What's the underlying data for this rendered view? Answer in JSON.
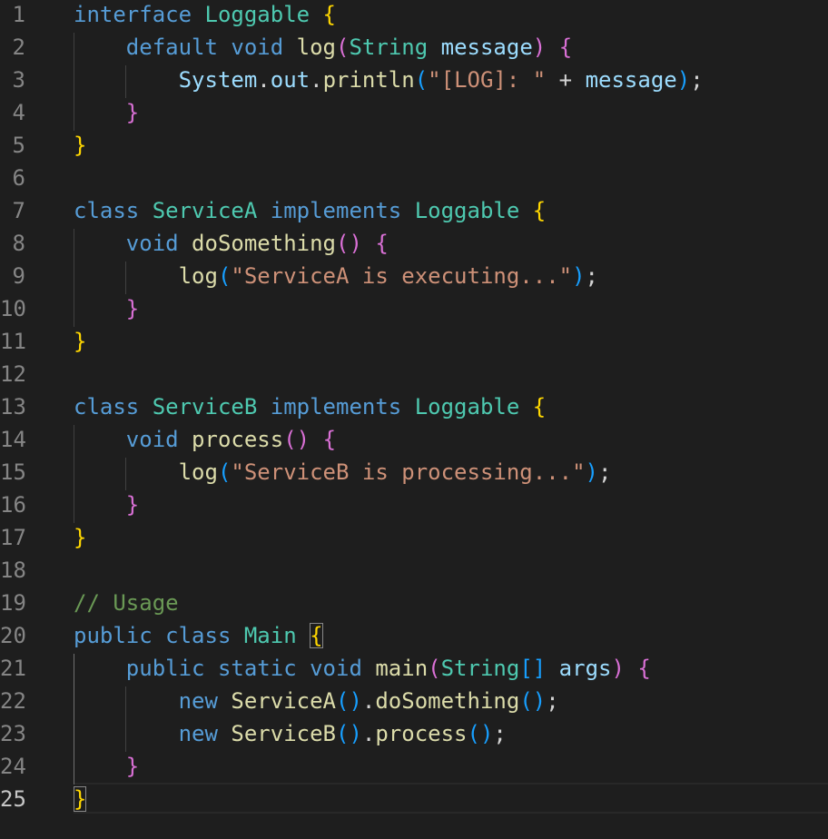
{
  "editor": {
    "language": "java",
    "active_line": 25,
    "colors": {
      "background": "#1e1e1e",
      "keyword": "#569cd6",
      "type": "#4ec9b0",
      "function": "#dcdcaa",
      "variable": "#9cdcfe",
      "string": "#ce9178",
      "comment": "#6a9955",
      "bracket_level1": "#ffd700",
      "bracket_level2": "#da70d6",
      "bracket_level3": "#179fff",
      "line_number": "#858585"
    },
    "lines": [
      {
        "number": "1",
        "tokens": [
          {
            "t": "interface",
            "c": "kw"
          },
          {
            "t": " ",
            "c": "pl"
          },
          {
            "t": "Loggable",
            "c": "ty"
          },
          {
            "t": " ",
            "c": "pl"
          },
          {
            "t": "{",
            "c": "b1"
          }
        ]
      },
      {
        "number": "2",
        "tokens": [
          {
            "t": "    ",
            "c": "pl"
          },
          {
            "t": "default",
            "c": "kw"
          },
          {
            "t": " ",
            "c": "pl"
          },
          {
            "t": "void",
            "c": "kw"
          },
          {
            "t": " ",
            "c": "pl"
          },
          {
            "t": "log",
            "c": "fn"
          },
          {
            "t": "(",
            "c": "b2"
          },
          {
            "t": "String",
            "c": "ty"
          },
          {
            "t": " ",
            "c": "pl"
          },
          {
            "t": "message",
            "c": "var"
          },
          {
            "t": ")",
            "c": "b2"
          },
          {
            "t": " ",
            "c": "pl"
          },
          {
            "t": "{",
            "c": "b2"
          }
        ]
      },
      {
        "number": "3",
        "tokens": [
          {
            "t": "        ",
            "c": "pl"
          },
          {
            "t": "System",
            "c": "var"
          },
          {
            "t": ".",
            "c": "pl"
          },
          {
            "t": "out",
            "c": "var"
          },
          {
            "t": ".",
            "c": "pl"
          },
          {
            "t": "println",
            "c": "fn"
          },
          {
            "t": "(",
            "c": "b3"
          },
          {
            "t": "\"[LOG]: \"",
            "c": "str"
          },
          {
            "t": " + ",
            "c": "pl"
          },
          {
            "t": "message",
            "c": "var"
          },
          {
            "t": ")",
            "c": "b3"
          },
          {
            "t": ";",
            "c": "pl"
          }
        ]
      },
      {
        "number": "4",
        "tokens": [
          {
            "t": "    ",
            "c": "pl"
          },
          {
            "t": "}",
            "c": "b2"
          }
        ]
      },
      {
        "number": "5",
        "tokens": [
          {
            "t": "}",
            "c": "b1"
          }
        ]
      },
      {
        "number": "6",
        "tokens": []
      },
      {
        "number": "7",
        "tokens": [
          {
            "t": "class",
            "c": "kw"
          },
          {
            "t": " ",
            "c": "pl"
          },
          {
            "t": "ServiceA",
            "c": "ty"
          },
          {
            "t": " ",
            "c": "pl"
          },
          {
            "t": "implements",
            "c": "kw"
          },
          {
            "t": " ",
            "c": "pl"
          },
          {
            "t": "Loggable",
            "c": "ty"
          },
          {
            "t": " ",
            "c": "pl"
          },
          {
            "t": "{",
            "c": "b1"
          }
        ]
      },
      {
        "number": "8",
        "tokens": [
          {
            "t": "    ",
            "c": "pl"
          },
          {
            "t": "void",
            "c": "kw"
          },
          {
            "t": " ",
            "c": "pl"
          },
          {
            "t": "doSomething",
            "c": "fn"
          },
          {
            "t": "()",
            "c": "b2"
          },
          {
            "t": " ",
            "c": "pl"
          },
          {
            "t": "{",
            "c": "b2"
          }
        ]
      },
      {
        "number": "9",
        "tokens": [
          {
            "t": "        ",
            "c": "pl"
          },
          {
            "t": "log",
            "c": "fn"
          },
          {
            "t": "(",
            "c": "b3"
          },
          {
            "t": "\"ServiceA is executing...\"",
            "c": "str"
          },
          {
            "t": ")",
            "c": "b3"
          },
          {
            "t": ";",
            "c": "pl"
          }
        ]
      },
      {
        "number": "10",
        "tokens": [
          {
            "t": "    ",
            "c": "pl"
          },
          {
            "t": "}",
            "c": "b2"
          }
        ]
      },
      {
        "number": "11",
        "tokens": [
          {
            "t": "}",
            "c": "b1"
          }
        ]
      },
      {
        "number": "12",
        "tokens": []
      },
      {
        "number": "13",
        "tokens": [
          {
            "t": "class",
            "c": "kw"
          },
          {
            "t": " ",
            "c": "pl"
          },
          {
            "t": "ServiceB",
            "c": "ty"
          },
          {
            "t": " ",
            "c": "pl"
          },
          {
            "t": "implements",
            "c": "kw"
          },
          {
            "t": " ",
            "c": "pl"
          },
          {
            "t": "Loggable",
            "c": "ty"
          },
          {
            "t": " ",
            "c": "pl"
          },
          {
            "t": "{",
            "c": "b1"
          }
        ]
      },
      {
        "number": "14",
        "tokens": [
          {
            "t": "    ",
            "c": "pl"
          },
          {
            "t": "void",
            "c": "kw"
          },
          {
            "t": " ",
            "c": "pl"
          },
          {
            "t": "process",
            "c": "fn"
          },
          {
            "t": "()",
            "c": "b2"
          },
          {
            "t": " ",
            "c": "pl"
          },
          {
            "t": "{",
            "c": "b2"
          }
        ]
      },
      {
        "number": "15",
        "tokens": [
          {
            "t": "        ",
            "c": "pl"
          },
          {
            "t": "log",
            "c": "fn"
          },
          {
            "t": "(",
            "c": "b3"
          },
          {
            "t": "\"ServiceB is processing...\"",
            "c": "str"
          },
          {
            "t": ")",
            "c": "b3"
          },
          {
            "t": ";",
            "c": "pl"
          }
        ]
      },
      {
        "number": "16",
        "tokens": [
          {
            "t": "    ",
            "c": "pl"
          },
          {
            "t": "}",
            "c": "b2"
          }
        ]
      },
      {
        "number": "17",
        "tokens": [
          {
            "t": "}",
            "c": "b1"
          }
        ]
      },
      {
        "number": "18",
        "tokens": []
      },
      {
        "number": "19",
        "tokens": [
          {
            "t": "// Usage",
            "c": "cmt"
          }
        ]
      },
      {
        "number": "20",
        "tokens": [
          {
            "t": "public",
            "c": "kw"
          },
          {
            "t": " ",
            "c": "pl"
          },
          {
            "t": "class",
            "c": "kw"
          },
          {
            "t": " ",
            "c": "pl"
          },
          {
            "t": "Main",
            "c": "ty"
          },
          {
            "t": " ",
            "c": "pl"
          },
          {
            "t": "{",
            "c": "b1",
            "m": true
          }
        ]
      },
      {
        "number": "21",
        "tokens": [
          {
            "t": "    ",
            "c": "pl"
          },
          {
            "t": "public",
            "c": "kw"
          },
          {
            "t": " ",
            "c": "pl"
          },
          {
            "t": "static",
            "c": "kw"
          },
          {
            "t": " ",
            "c": "pl"
          },
          {
            "t": "void",
            "c": "kw"
          },
          {
            "t": " ",
            "c": "pl"
          },
          {
            "t": "main",
            "c": "fn"
          },
          {
            "t": "(",
            "c": "b2"
          },
          {
            "t": "String",
            "c": "ty"
          },
          {
            "t": "[]",
            "c": "b3"
          },
          {
            "t": " ",
            "c": "pl"
          },
          {
            "t": "args",
            "c": "var"
          },
          {
            "t": ")",
            "c": "b2"
          },
          {
            "t": " ",
            "c": "pl"
          },
          {
            "t": "{",
            "c": "b2"
          }
        ]
      },
      {
        "number": "22",
        "tokens": [
          {
            "t": "        ",
            "c": "pl"
          },
          {
            "t": "new",
            "c": "kw"
          },
          {
            "t": " ",
            "c": "pl"
          },
          {
            "t": "ServiceA",
            "c": "fn"
          },
          {
            "t": "()",
            "c": "b3"
          },
          {
            "t": ".",
            "c": "pl"
          },
          {
            "t": "doSomething",
            "c": "fn"
          },
          {
            "t": "()",
            "c": "b3"
          },
          {
            "t": ";",
            "c": "pl"
          }
        ]
      },
      {
        "number": "23",
        "tokens": [
          {
            "t": "        ",
            "c": "pl"
          },
          {
            "t": "new",
            "c": "kw"
          },
          {
            "t": " ",
            "c": "pl"
          },
          {
            "t": "ServiceB",
            "c": "fn"
          },
          {
            "t": "()",
            "c": "b3"
          },
          {
            "t": ".",
            "c": "pl"
          },
          {
            "t": "process",
            "c": "fn"
          },
          {
            "t": "()",
            "c": "b3"
          },
          {
            "t": ";",
            "c": "pl"
          }
        ]
      },
      {
        "number": "24",
        "tokens": [
          {
            "t": "    ",
            "c": "pl"
          },
          {
            "t": "}",
            "c": "b2"
          }
        ]
      },
      {
        "number": "25",
        "tokens": [
          {
            "t": "}",
            "c": "b1",
            "m": true
          }
        ]
      }
    ]
  }
}
